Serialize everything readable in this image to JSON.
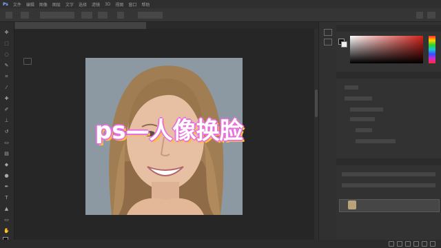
{
  "menubar": {
    "items": [
      "Ps",
      "文件",
      "编辑",
      "图像",
      "图层",
      "文字",
      "选择",
      "滤镜",
      "3D",
      "视图",
      "窗口",
      "帮助"
    ]
  },
  "document": {
    "tab_label": "",
    "zoom_text": ""
  },
  "overlay": {
    "title": "ps—人像换脸"
  },
  "panels": {
    "color_label": "",
    "properties_label": "",
    "layers_label": ""
  },
  "layer": {
    "name": ""
  },
  "colors": {
    "accent": "#e86fdc",
    "shadow": "#ffbf3c",
    "ui_dark": "#2c2c2c"
  }
}
